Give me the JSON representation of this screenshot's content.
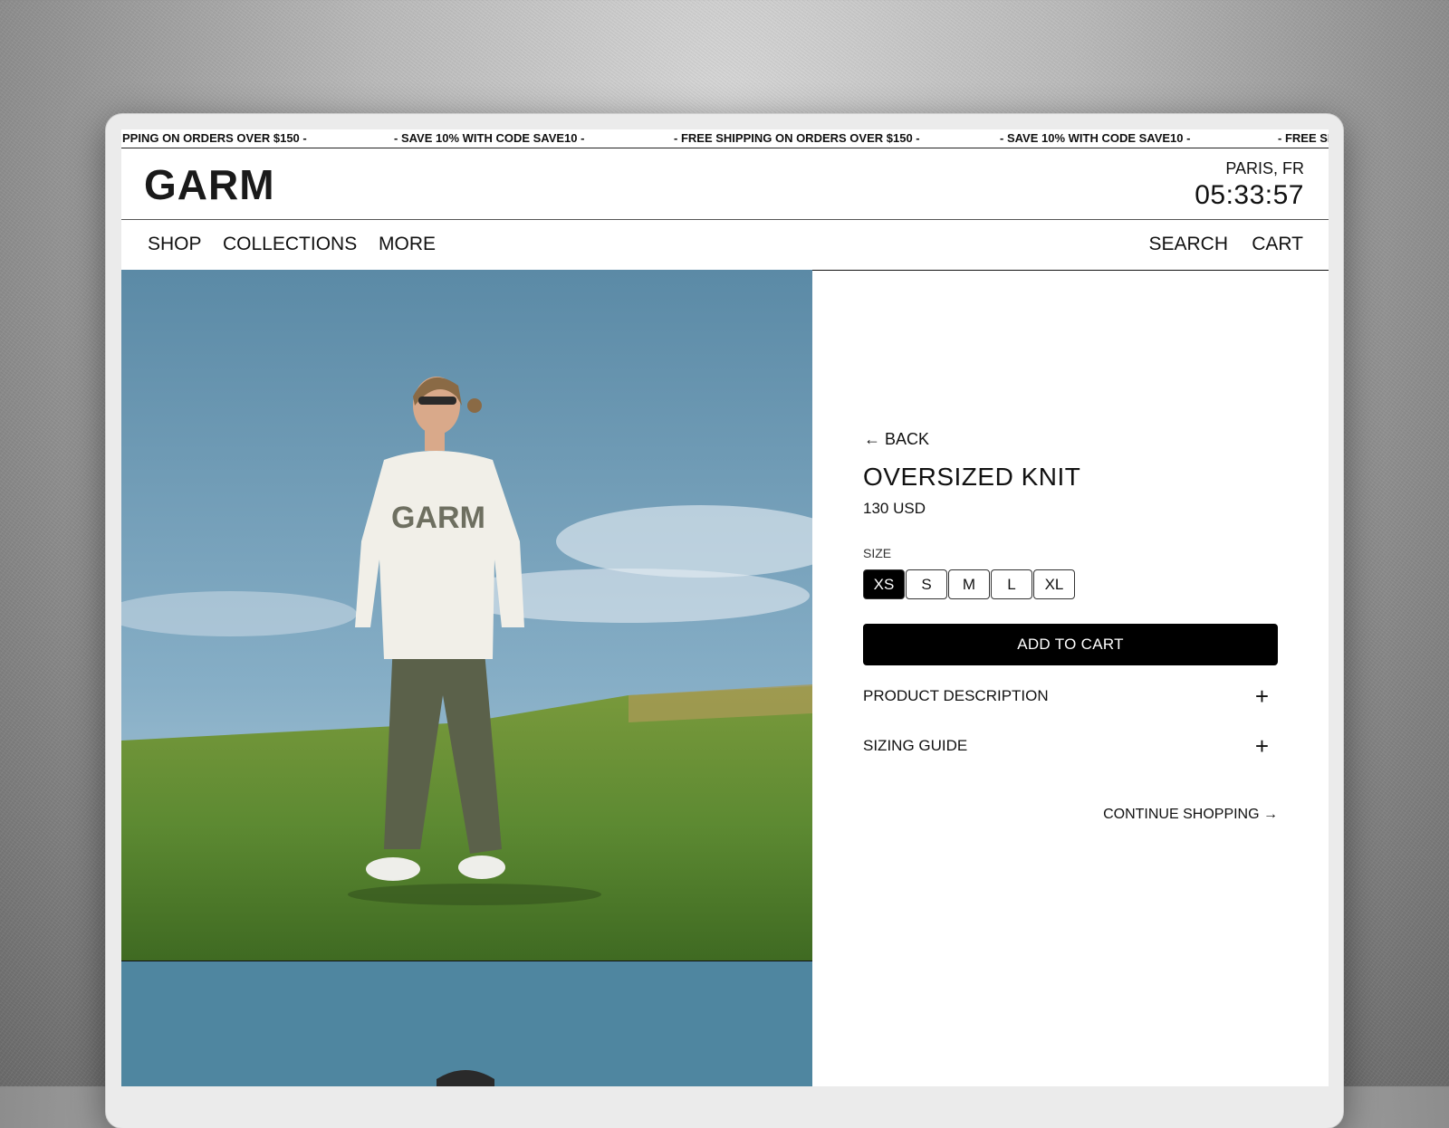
{
  "ticker": {
    "items": [
      "PPING ON ORDERS OVER $150 -",
      "- SAVE 10% WITH CODE SAVE10 -",
      "- FREE SHIPPING ON ORDERS OVER $150 -",
      "- SAVE 10% WITH CODE SAVE10 -",
      "- FREE SH"
    ]
  },
  "header": {
    "logo": "GARM",
    "city": "PARIS, FR",
    "time": "05:33:57"
  },
  "nav": {
    "left": [
      "SHOP",
      "COLLECTIONS",
      "MORE"
    ],
    "right": [
      "SEARCH",
      "CART"
    ]
  },
  "product": {
    "back": "← BACK",
    "name": "OVERSIZED KNIT",
    "price": "130 USD",
    "size_label": "SIZE",
    "sizes": [
      "XS",
      "S",
      "M",
      "L",
      "XL"
    ],
    "selected_size": "XS",
    "add_to_cart": "ADD TO CART",
    "accordions": [
      {
        "label": "PRODUCT DESCRIPTION",
        "icon": "+"
      },
      {
        "label": "SIZING GUIDE",
        "icon": "+"
      }
    ],
    "continue": "CONTINUE SHOPPING →"
  },
  "image_text": {
    "sweater_print": "GARM"
  },
  "colors": {
    "sky": "#6f9fba",
    "grass": "#5d8a32",
    "button_bg": "#000000"
  }
}
